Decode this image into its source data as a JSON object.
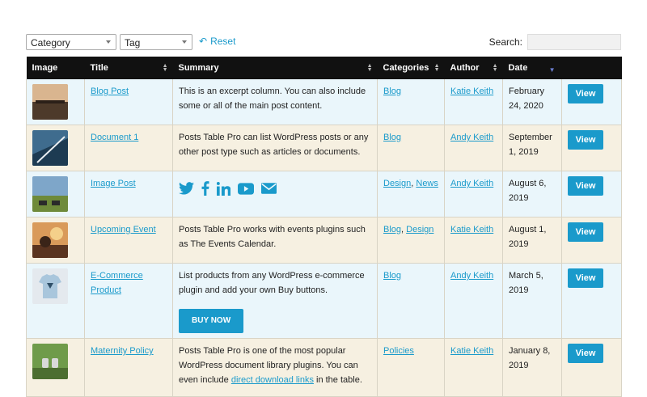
{
  "filters": {
    "category_label": "Category",
    "tag_label": "Tag",
    "reset_label": "Reset",
    "search_label": "Search:"
  },
  "table": {
    "columns": [
      "Image",
      "Title",
      "Summary",
      "Categories",
      "Author",
      "Date"
    ],
    "view_label": "View",
    "rows": [
      {
        "title": "Blog Post",
        "summary": "This is an excerpt column. You can also include some or all of the main post content.",
        "categories": [
          "Blog"
        ],
        "author": "Katie Keith",
        "date": "February 24, 2020"
      },
      {
        "title": "Document 1",
        "summary": "Posts Table Pro can list WordPress posts or any other post type such as articles or documents.",
        "categories": [
          "Blog"
        ],
        "author": "Andy Keith",
        "date": "September 1, 2019"
      },
      {
        "title": "Image Post",
        "summary": "",
        "social_icons": [
          "twitter-icon",
          "facebook-icon",
          "linkedin-icon",
          "youtube-icon",
          "email-icon"
        ],
        "categories": [
          "Design",
          "News"
        ],
        "author": "Andy Keith",
        "date": "August 6, 2019"
      },
      {
        "title": "Upcoming Event",
        "summary": "Posts Table Pro works with events plugins such as The Events Calendar.",
        "categories": [
          "Blog",
          "Design"
        ],
        "author": "Katie Keith",
        "date": "August 1, 2019"
      },
      {
        "title": "E-Commerce Product",
        "summary": "List products from any WordPress e-commerce plugin and add your own Buy buttons.",
        "buy_label": "BUY NOW",
        "categories": [
          "Blog"
        ],
        "author": "Andy Keith",
        "date": "March 5, 2019"
      },
      {
        "title": "Maternity Policy",
        "summary_pre": "Posts Table Pro is one of the most popular WordPress document library plugins. You can even include ",
        "summary_link": "direct download links",
        "summary_post": " in the table.",
        "categories": [
          "Policies"
        ],
        "author": "Katie Keith",
        "date": "January 8, 2019"
      }
    ]
  },
  "colors": {
    "accent": "#1a9acb",
    "header_bg": "#111111",
    "row_blue": "#eaf6fb",
    "row_beige": "#f6f0e1"
  }
}
